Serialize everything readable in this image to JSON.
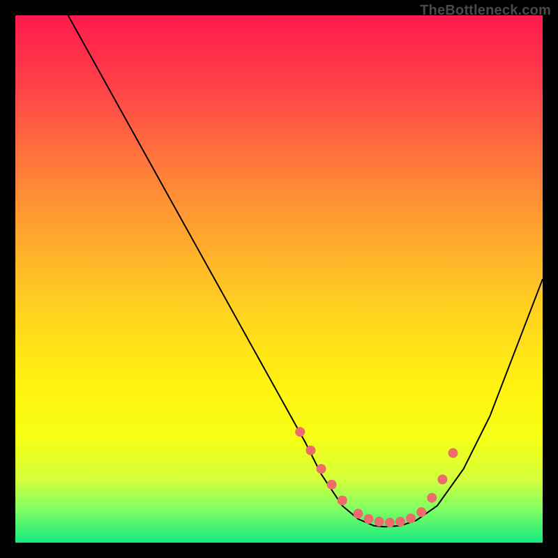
{
  "watermark": "TheBottleneck.com",
  "chart_data": {
    "type": "line",
    "title": "",
    "xlabel": "",
    "ylabel": "",
    "xlim": [
      0,
      100
    ],
    "ylim": [
      0,
      100
    ],
    "series": [
      {
        "name": "curve",
        "x": [
          10,
          15,
          20,
          25,
          30,
          35,
          40,
          45,
          50,
          55,
          58,
          60,
          62,
          65,
          68,
          70,
          73,
          76,
          80,
          85,
          90,
          95,
          100
        ],
        "y": [
          100,
          91,
          82,
          73,
          64,
          55,
          46,
          37,
          28,
          19,
          13,
          10,
          7,
          4.5,
          3.2,
          3.0,
          3.2,
          4.2,
          7,
          14,
          24,
          37,
          50
        ]
      }
    ],
    "markers": {
      "name": "dots",
      "x": [
        54,
        56,
        58,
        60,
        62,
        65,
        67,
        69,
        71,
        73,
        75,
        77,
        79,
        81,
        83
      ],
      "y": [
        21,
        17.5,
        14,
        11,
        8,
        5.5,
        4.5,
        4.0,
        3.8,
        4.0,
        4.6,
        5.8,
        8.5,
        12,
        17
      ]
    },
    "gradient_stops": [
      {
        "pct": 0,
        "color": "#ff1a4d"
      },
      {
        "pct": 6,
        "color": "#ff2b4b"
      },
      {
        "pct": 14,
        "color": "#ff4348"
      },
      {
        "pct": 24,
        "color": "#ff6a3f"
      },
      {
        "pct": 33,
        "color": "#ff8a36"
      },
      {
        "pct": 44,
        "color": "#ffad2c"
      },
      {
        "pct": 56,
        "color": "#ffd21f"
      },
      {
        "pct": 70,
        "color": "#fff210"
      },
      {
        "pct": 80,
        "color": "#f6ff14"
      },
      {
        "pct": 88,
        "color": "#d4ff3a"
      },
      {
        "pct": 94,
        "color": "#7bff66"
      },
      {
        "pct": 100,
        "color": "#13e97e"
      }
    ],
    "marker_color": "#ec6b6b",
    "curve_color": "#000000"
  }
}
